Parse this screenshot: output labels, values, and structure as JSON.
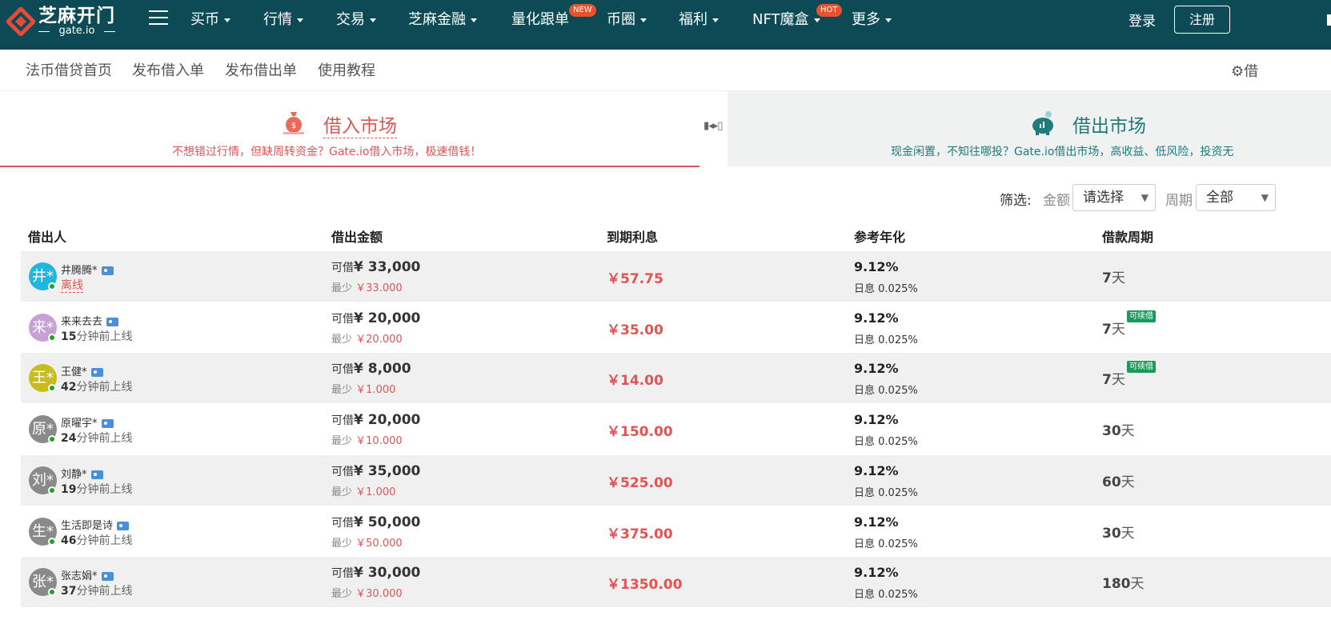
{
  "header": {
    "logo_cn": "芝麻开门",
    "logo_en": "gate.io",
    "nav": [
      {
        "label": "买币",
        "caret": true
      },
      {
        "label": "行情",
        "caret": true
      },
      {
        "label": "交易",
        "caret": true
      },
      {
        "label": "芝麻金融",
        "caret": true
      },
      {
        "label": "量化跟单",
        "caret": false,
        "badge": "NEW"
      },
      {
        "label": "币圈",
        "caret": true
      },
      {
        "label": "福利",
        "caret": true
      },
      {
        "label": "NFT魔盒",
        "caret": true,
        "badge": "HOT"
      },
      {
        "label": "更多",
        "caret": true
      }
    ],
    "login": "登录",
    "register": "注册"
  },
  "subnav": {
    "items": [
      "法币借贷首页",
      "发布借入单",
      "发布借出单",
      "使用教程"
    ],
    "settings": "借"
  },
  "tabs": {
    "borrow": {
      "title": "借入市场",
      "subtitle": "不想错过行情，但缺周转资金？Gate.io借入市场，极速借钱！"
    },
    "lend": {
      "title": "借出市场",
      "subtitle": "现金闲置，不知往哪投？Gate.io借出市场，高收益、低风险，投资无"
    }
  },
  "filter": {
    "label": "筛选:",
    "amount_label": "金额",
    "amount_value": "请选择",
    "period_label": "周期",
    "period_value": "全部"
  },
  "table": {
    "headers": [
      "借出人",
      "借出金额",
      "到期利息",
      "参考年化",
      "借款周期"
    ],
    "labels": {
      "can_borrow": "可借",
      "min": "最少",
      "daily": "日息",
      "renew": "可续借"
    },
    "rows": [
      {
        "initial": "井*",
        "avatar_color": "#1fb6e0",
        "name": "井腾腾*",
        "status_num": "",
        "status_text": "离线",
        "offline": true,
        "amount": "¥ 33,000",
        "min": "￥33.000",
        "interest": "￥57.75",
        "annual": "9.12%",
        "daily": "0.025%",
        "period_num": "7",
        "period_unit": "天",
        "renew": false
      },
      {
        "initial": "来*",
        "avatar_color": "#c9a0d6",
        "name": "来来去去",
        "status_num": "15",
        "status_text": "分钟前上线",
        "offline": false,
        "amount": "¥ 20,000",
        "min": "￥20.000",
        "interest": "￥35.00",
        "annual": "9.12%",
        "daily": "0.025%",
        "period_num": "7",
        "period_unit": "天",
        "renew": true
      },
      {
        "initial": "王*",
        "avatar_color": "#c8bd1e",
        "name": "王健*",
        "status_num": "42",
        "status_text": "分钟前上线",
        "offline": false,
        "amount": "¥ 8,000",
        "min": "￥1.000",
        "interest": "￥14.00",
        "annual": "9.12%",
        "daily": "0.025%",
        "period_num": "7",
        "period_unit": "天",
        "renew": true
      },
      {
        "initial": "原*",
        "avatar_color": "#8a8a8a",
        "name": "原曜宇*",
        "status_num": "24",
        "status_text": "分钟前上线",
        "offline": false,
        "amount": "¥ 20,000",
        "min": "￥10.000",
        "interest": "￥150.00",
        "annual": "9.12%",
        "daily": "0.025%",
        "period_num": "30",
        "period_unit": "天",
        "renew": false
      },
      {
        "initial": "刘*",
        "avatar_color": "#8a8a8a",
        "name": "刘静*",
        "status_num": "19",
        "status_text": "分钟前上线",
        "offline": false,
        "amount": "¥ 35,000",
        "min": "￥1.000",
        "interest": "￥525.00",
        "annual": "9.12%",
        "daily": "0.025%",
        "period_num": "60",
        "period_unit": "天",
        "renew": false
      },
      {
        "initial": "生*",
        "avatar_color": "#8a8a8a",
        "name": "生活即是诗",
        "status_num": "46",
        "status_text": "分钟前上线",
        "offline": false,
        "amount": "¥ 50,000",
        "min": "￥50.000",
        "interest": "￥375.00",
        "annual": "9.12%",
        "daily": "0.025%",
        "period_num": "30",
        "period_unit": "天",
        "renew": false
      },
      {
        "initial": "张*",
        "avatar_color": "#8a8a8a",
        "name": "张志娟*",
        "status_num": "37",
        "status_text": "分钟前上线",
        "offline": false,
        "amount": "¥ 30,000",
        "min": "￥30.000",
        "interest": "￥1350.00",
        "annual": "9.12%",
        "daily": "0.025%",
        "period_num": "180",
        "period_unit": "天",
        "renew": false
      }
    ]
  }
}
